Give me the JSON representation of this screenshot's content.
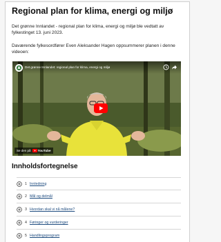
{
  "article": {
    "title": "Regional plan for klima, energi og miljø",
    "intro_paragraph": "Det grønne Innlandet -  regional plan for klima, energi og miljø ble vedtatt av fylkestinget 13. juni 2023.",
    "video_intro": "Daværende fylkesordfører Even Aleksander Hagen oppsummerer planen i denne videoen:"
  },
  "video": {
    "title": "Det grønne Innlandet: regional plan for klima, energi og miljø",
    "watch_on_label": "Se den på",
    "platform_name": "YouTube",
    "icons": [
      "channel-logo",
      "clock-icon",
      "share-icon",
      "play-button",
      "youtube-logo"
    ]
  },
  "toc": {
    "heading": "Innholdsfortegnelse",
    "items": [
      {
        "number": "1",
        "label": "Innledning"
      },
      {
        "number": "2",
        "label": "Mål og delmål"
      },
      {
        "number": "3",
        "label": "Hvordan skal vi nå målene?"
      },
      {
        "number": "4",
        "label": "Føringer og vurderinger"
      },
      {
        "number": "5",
        "label": "Handlingsprogram"
      }
    ]
  },
  "colors": {
    "link": "#1c4a7e",
    "youtube_red": "#ff0000",
    "video_shirt": "#e8e23a",
    "video_forest": "#3e4a27"
  }
}
